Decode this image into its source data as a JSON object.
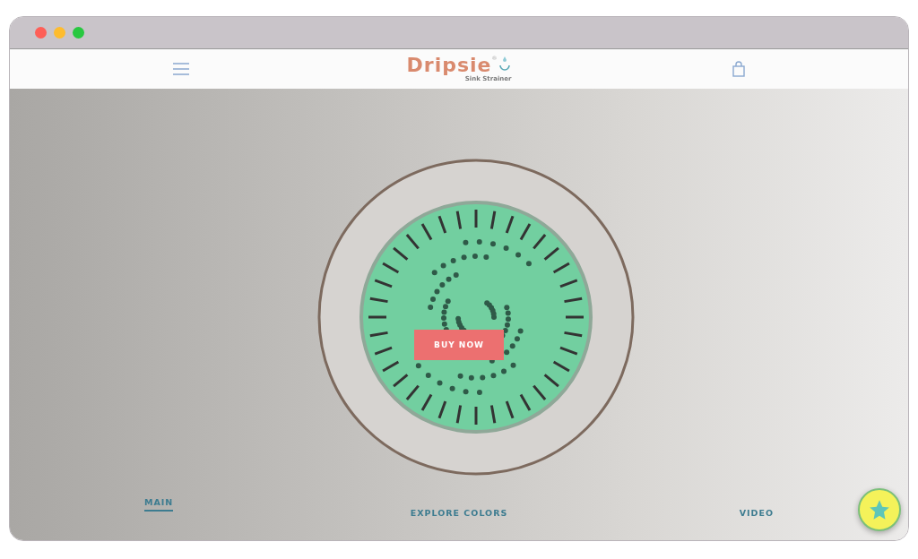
{
  "header": {
    "logo": "Dripsie",
    "logo_mark": "®",
    "tagline": "Sink Strainer"
  },
  "hero": {
    "button": "BUY NOW"
  },
  "tabs": [
    {
      "label": "MAIN",
      "selected": true
    },
    {
      "label": "EXPLORE COLORS",
      "selected": false
    },
    {
      "label": "VIDEO",
      "selected": false
    }
  ]
}
